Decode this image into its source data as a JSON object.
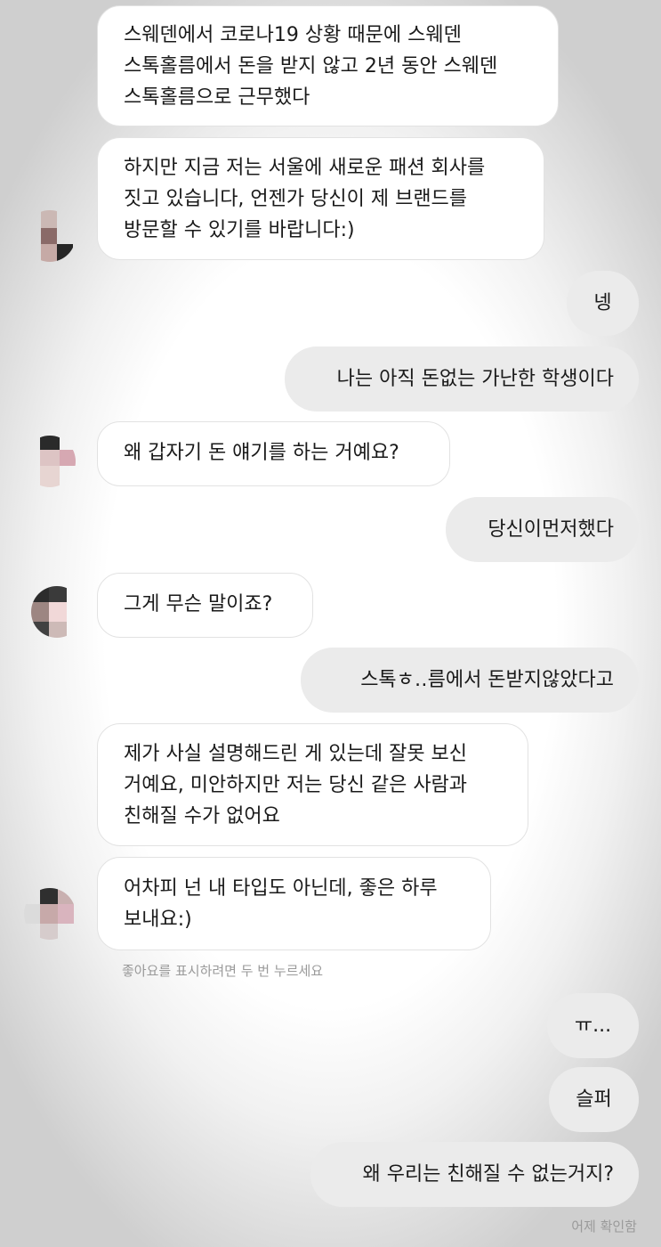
{
  "messages": {
    "m1": "스웨덴에서 코로나19 상황 때문에 스웨덴\n스톡홀름에서 돈을 받지 않고 2년 동안 스웨덴\n스톡홀름으로 근무했다",
    "m2": "하지만 지금 저는 서울에 새로운 패션 회사를\n짓고 있습니다, 언젠가 당신이 제 브랜드를\n방문할 수 있기를 바랍니다:)",
    "m3": "넹",
    "m4": "나는 아직 돈없는 가난한 학생이다",
    "m5": "왜 갑자기 돈 얘기를 하는 거예요?",
    "m6": "당신이먼저했다",
    "m7": "그게 무슨 말이죠?",
    "m8": "스톡ㅎ‥름에서 돈받지않았다고",
    "m9": "제가 사실 설명해드린 게 있는데 잘못 보신\n거예요, 미안하지만 저는 당신 같은 사람과\n친해질 수가 없어요",
    "m10": "어차피 넌 내 타입도 아닌데, 좋은 하루\n보내요:)",
    "m11": "ㅠ...",
    "m12": "슬퍼",
    "m13": "왜 우리는 친해질 수 없는거지?"
  },
  "hints": {
    "like_hint": "좋아요를 표시하려면 두 번 누르세요",
    "read_receipt": "어제 확인함"
  },
  "colors": {
    "incoming_bubble": "#ffffff",
    "outgoing_bubble": "#ebebeb",
    "text": "#1a1a1a",
    "hint_text": "#9a9a9a"
  }
}
